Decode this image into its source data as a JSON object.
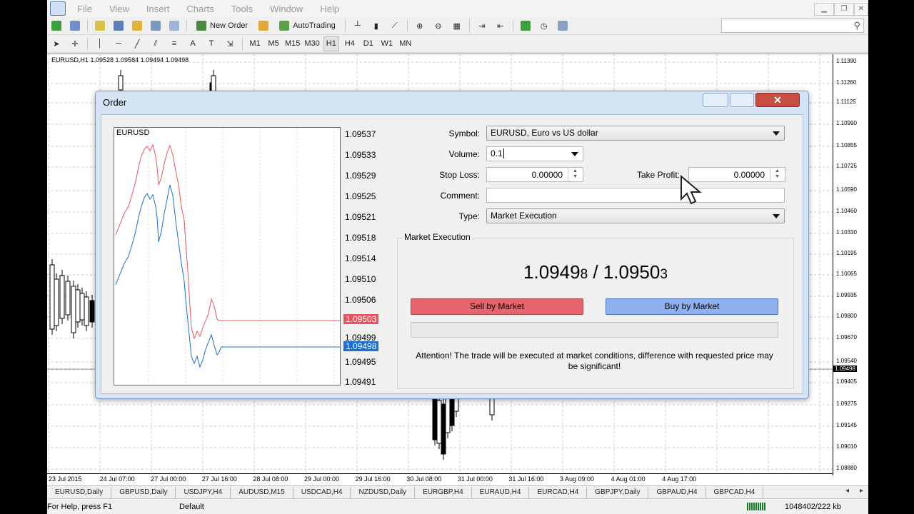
{
  "menu": [
    "File",
    "View",
    "Insert",
    "Charts",
    "Tools",
    "Window",
    "Help"
  ],
  "toolbar": {
    "new_order": "New Order",
    "autotrading": "AutoTrading"
  },
  "timeframes": [
    "M1",
    "M5",
    "M15",
    "M30",
    "H1",
    "H4",
    "D1",
    "W1",
    "MN"
  ],
  "active_timeframe": "H1",
  "chart": {
    "header": "EURUSD,H1  1.09528 1.09584 1.09494 1.09498",
    "y_ticks": [
      "1.11390",
      "1.11260",
      "1.11125",
      "1.10990",
      "1.10855",
      "1.10725",
      "1.10590",
      "1.10460",
      "1.10330",
      "1.10195",
      "1.10065",
      "1.09935",
      "1.09800",
      "1.09670",
      "1.09540",
      "1.09498",
      "1.09405",
      "1.09275",
      "1.09145",
      "1.09010",
      "1.08880"
    ],
    "current_price": "1.09498",
    "x_ticks": [
      "23 Jul 2015",
      "24 Jul 07:00",
      "27 Jul 00:00",
      "27 Jul 16:00",
      "28 Jul 08:00",
      "29 Jul 00:00",
      "29 Jul 16:00",
      "30 Jul 08:00",
      "31 Jul 00:00",
      "31 Jul 16:00",
      "3 Aug 09:00",
      "4 Aug 01:00",
      "4 Aug 17:00"
    ]
  },
  "tabs": [
    "EURUSD,Daily",
    "GBPUSD,Daily",
    "USDJPY,H4",
    "AUDUSD,M15",
    "USDCAD,H4",
    "NZDUSD,Daily",
    "EURGBP,H4",
    "EURAUD,H4",
    "EURCAD,H4",
    "GBPJPY,Daily",
    "GBPAUD,H4",
    "GBPCAD,H4"
  ],
  "status": {
    "help": "For Help, press F1",
    "profile": "Default",
    "traffic": "1048402/222 kb"
  },
  "dialog": {
    "title": "Order",
    "mini_symbol": "EURUSD",
    "mini_ticks": [
      "1.09537",
      "1.09533",
      "1.09529",
      "1.09525",
      "1.09521",
      "1.09518",
      "1.09514",
      "1.09510",
      "1.09506",
      "1.09503",
      "1.09499",
      "1.09498",
      "1.09495",
      "1.09491"
    ],
    "ask": "1.09503",
    "bid": "1.09498",
    "symbol_label": "Symbol:",
    "symbol_value": "EURUSD, Euro vs US dollar",
    "volume_label": "Volume:",
    "volume_value": "0.1",
    "stoploss_label": "Stop Loss:",
    "stoploss_value": "0.00000",
    "takeprofit_label": "Take Profit:",
    "takeprofit_value": "0.00000",
    "comment_label": "Comment:",
    "comment_value": "",
    "type_label": "Type:",
    "type_value": "Market Execution",
    "group_title": "Market Execution",
    "bid_main": "1.0949",
    "bid_small": "8",
    "sep": " / ",
    "ask_main": "1.0950",
    "ask_small": "3",
    "sell_label": "Sell by Market",
    "buy_label": "Buy by Market",
    "warning": "Attention! The trade will be executed at market conditions, difference with requested price may be significant!"
  }
}
